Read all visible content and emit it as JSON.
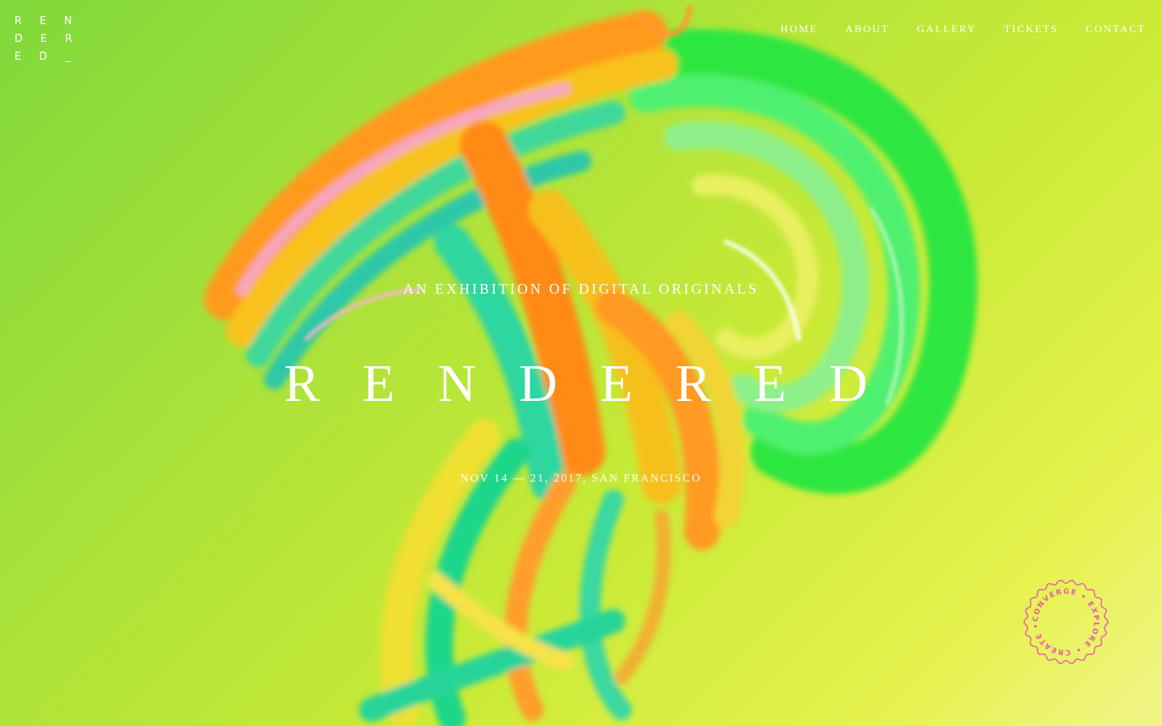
{
  "logo": {
    "line1": "R E N",
    "line2": "D E R",
    "line3": "E D _"
  },
  "nav": [
    {
      "label": "HOME"
    },
    {
      "label": "ABOUT"
    },
    {
      "label": "GALLERY"
    },
    {
      "label": "TICKETS"
    },
    {
      "label": "CONTACT"
    }
  ],
  "hero": {
    "subtitle": "AN EXHIBITION OF DIGITAL ORIGINALS",
    "title": "RENDERED",
    "date": "NOV 14 — 21, 2017, SAN FRANCISCO"
  },
  "badge": {
    "text": "CONVERGE • EXPLORE • CREATE • ",
    "color": "#e85aa8"
  }
}
